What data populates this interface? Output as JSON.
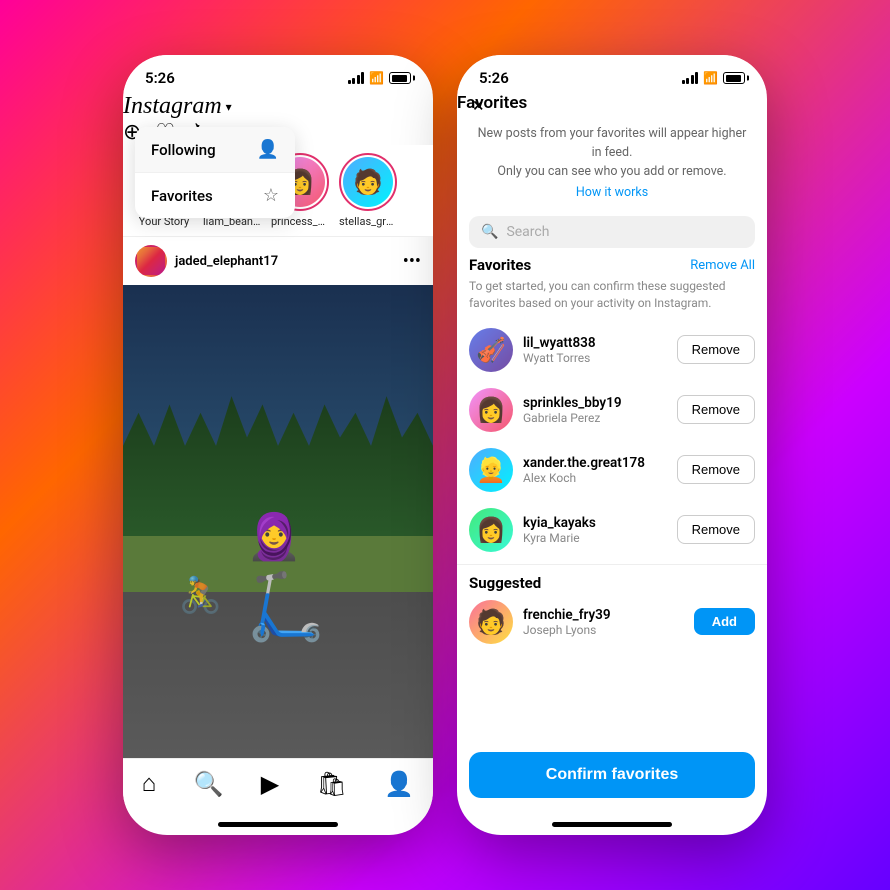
{
  "background": {
    "gradient": "linear-gradient(135deg, #ff0099, #ff6600, #cc00ff, #6600ff)"
  },
  "left_phone": {
    "status": {
      "time": "5:26",
      "signal": "full",
      "wifi": true,
      "battery": "full"
    },
    "header": {
      "logo": "Instagram",
      "logo_arrow": "˅",
      "icons": [
        "add",
        "heart",
        "messenger"
      ]
    },
    "dropdown": {
      "items": [
        {
          "label": "Following",
          "icon": "person-add"
        },
        {
          "label": "Favorites",
          "icon": "star"
        }
      ]
    },
    "stories": [
      {
        "name": "Your Story",
        "type": "your"
      },
      {
        "name": "liam_bean...",
        "type": "avatar"
      },
      {
        "name": "princess_p...",
        "type": "avatar"
      },
      {
        "name": "stellas_gr0...",
        "type": "avatar"
      }
    ],
    "post": {
      "username": "jaded_elephant17",
      "image_alt": "Person riding scooter"
    },
    "nav": [
      "home",
      "search",
      "reels",
      "shop",
      "profile"
    ]
  },
  "right_phone": {
    "status": {
      "time": "5:26",
      "signal": "full",
      "wifi": true,
      "battery": "full"
    },
    "header": {
      "close_icon": "×",
      "title": "Favorites"
    },
    "info": {
      "description": "New posts from your favorites will appear higher in feed.\nOnly you can see who you add or remove.",
      "link": "How it works"
    },
    "search": {
      "placeholder": "Search"
    },
    "favorites_section": {
      "title": "Favorites",
      "remove_all": "Remove All",
      "description": "To get started, you can confirm these suggested favorites based on your activity on Instagram.",
      "users": [
        {
          "handle": "lil_wyatt838",
          "name": "Wyatt Torres",
          "action": "Remove"
        },
        {
          "handle": "sprinkles_bby19",
          "name": "Gabriela Perez",
          "action": "Remove"
        },
        {
          "handle": "xander.the.great178",
          "name": "Alex Koch",
          "action": "Remove"
        },
        {
          "handle": "kyia_kayaks",
          "name": "Kyra Marie",
          "action": "Remove"
        }
      ]
    },
    "suggested_section": {
      "title": "Suggested",
      "users": [
        {
          "handle": "frenchie_fry39",
          "name": "Joseph Lyons",
          "action": "Add"
        }
      ]
    },
    "confirm_button": "Confirm favorites"
  }
}
